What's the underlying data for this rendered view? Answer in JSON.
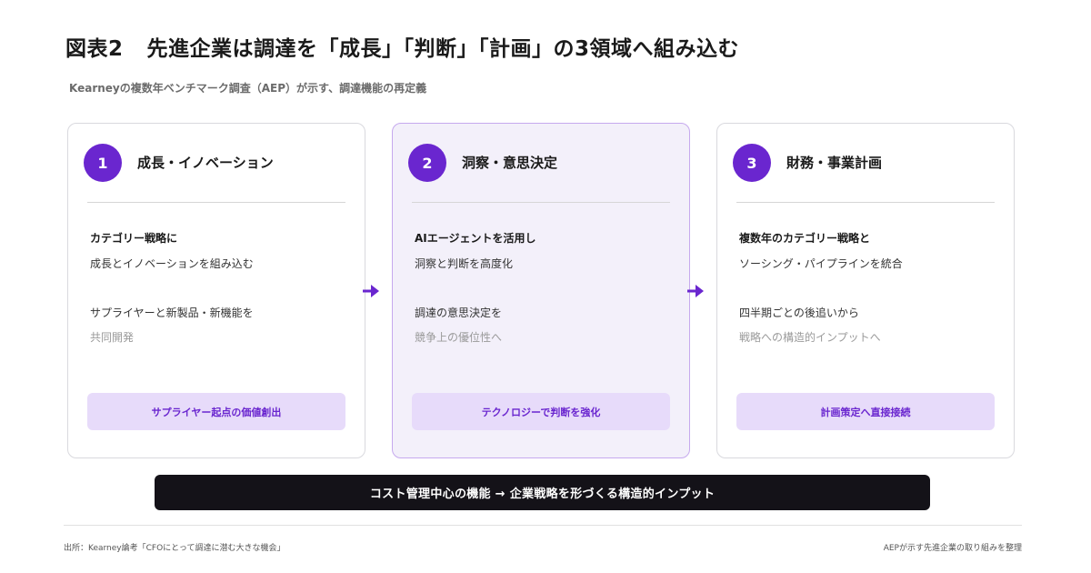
{
  "header": {
    "figure_number": "図表2",
    "title": "先進企業は調達を「成長」「判断」「計画」の3領域へ組み込む",
    "subtitle": "Kearneyの複数年ベンチマーク調査（AEP）が示す、調達機能の再定義"
  },
  "cards": [
    {
      "number": "1",
      "title": "成長・イノベーション",
      "line1": "カテゴリー戦略に",
      "line2": "成長とイノベーションを組み込む",
      "line3": "サプライヤーと新製品・新機能を",
      "line4": "共同開発",
      "pill": "サプライヤー起点の価値創出"
    },
    {
      "number": "2",
      "title": "洞察・意思決定",
      "line1": "AIエージェントを活用し",
      "line2": "洞察と判断を高度化",
      "line3": "調達の意思決定を",
      "line4": "競争上の優位性へ",
      "pill": "テクノロジーで判断を強化"
    },
    {
      "number": "3",
      "title": "財務・事業計画",
      "line1": "複数年のカテゴリー戦略と",
      "line2": "ソーシング・パイプラインを統合",
      "line3": "四半期ごとの後追いから",
      "line4": "戦略への構造的インプットへ",
      "pill": "計画策定へ直接接続"
    }
  ],
  "summary_bar": "コスト管理中心の機能 → 企業戦略を形づくる構造的インプット",
  "footer": {
    "source": "出所：Kearney論考「CFOにとって調達に潜む大きな機会」",
    "note": "AEPが示す先進企業の取り組みを整理"
  },
  "colors": {
    "accent": "#6a26cf",
    "pill_background": "#e7dbfa",
    "highlight_card_background": "#f3f0fa",
    "highlight_card_border": "#c6a9ee",
    "summary_bar_background": "#141218"
  },
  "icons": [
    "arrow-right-icon",
    "arrow-right-icon"
  ]
}
